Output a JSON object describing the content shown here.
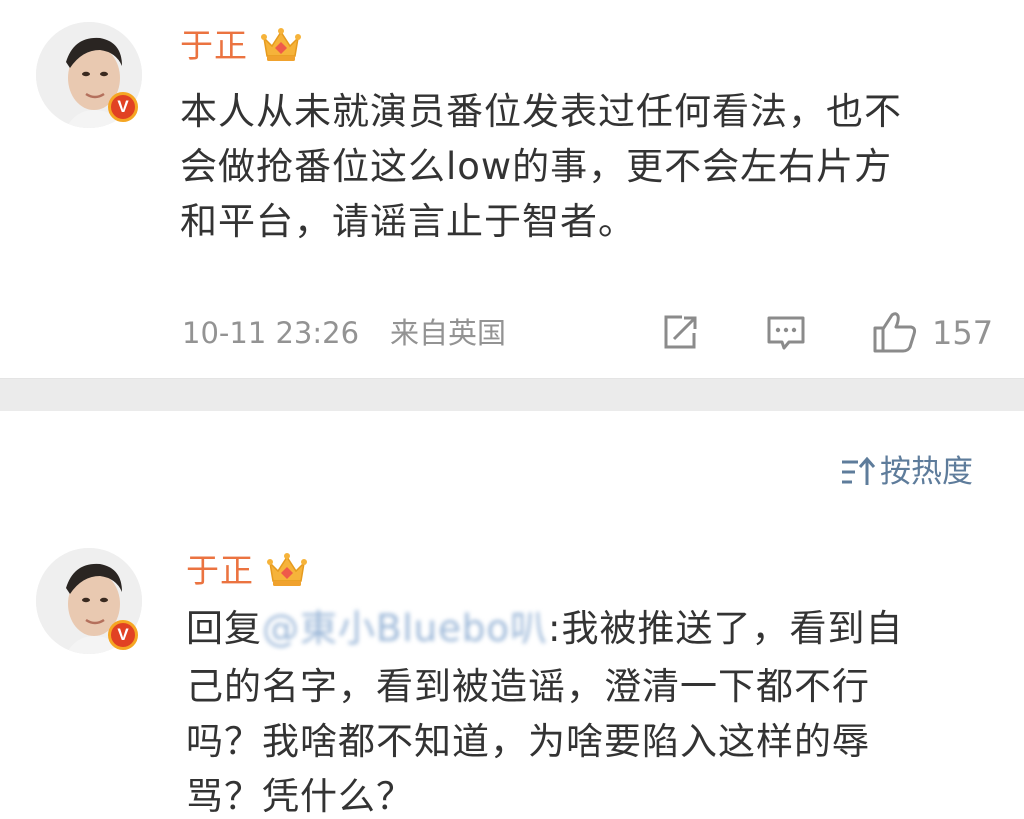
{
  "post": {
    "username": "于正",
    "text_lines": [
      "本人从未就演员番位发表过任何看法，也不",
      "会做抢番位这么low的事，更不会左右片方",
      "和平台，请谣言止于智者。"
    ],
    "timestamp": "10-11 23:26",
    "location": "来自英国",
    "like_count": "157"
  },
  "sort": {
    "label": "按热度"
  },
  "reply": {
    "username": "于正",
    "reply_prefix": "回复",
    "reply_target": "@東小Bluebo叭",
    "text_line1_rest": ":我被推送了，看到自",
    "text_lines": [
      "己的名字，看到被造谣，澄清一下都不行",
      "吗？我啥都不知道，为啥要陷入这样的辱",
      "骂？凭什么？"
    ]
  },
  "colors": {
    "username": "#eb7340",
    "body_text": "#333333",
    "meta_text": "#939393",
    "link": "#5e7c9b",
    "separator": "#ebebeb",
    "verified_badge": "#e14123"
  },
  "icons": {
    "verified": "verified-v-icon",
    "vip": "crown-vip-icon",
    "share": "share-icon",
    "comment": "comment-icon",
    "like": "thumbs-up-icon",
    "sort": "sort-icon"
  }
}
